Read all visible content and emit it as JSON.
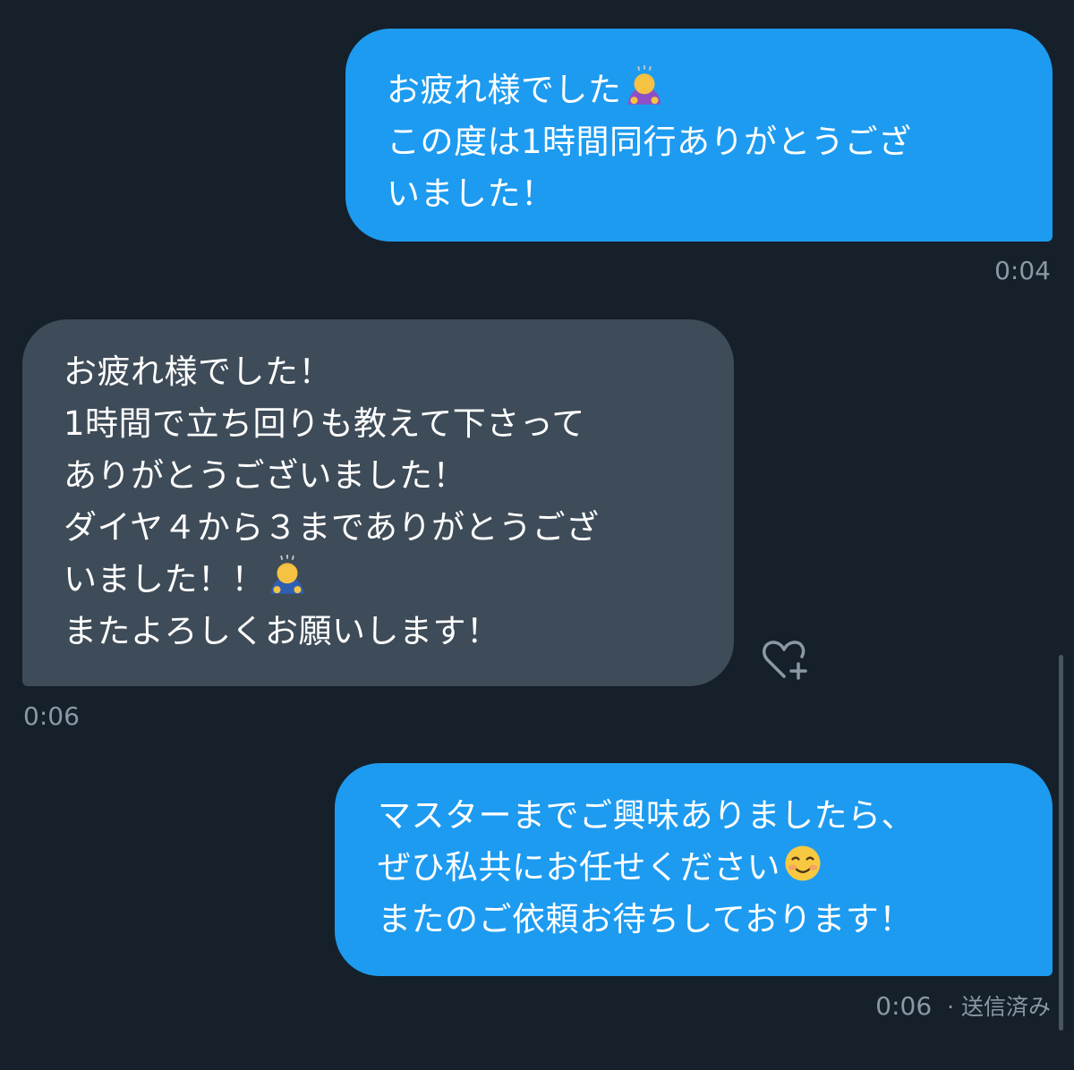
{
  "conversation": {
    "messages": [
      {
        "direction": "outgoing",
        "lines": [
          "お疲れ様でした",
          "この度は1時間同行ありがとうござ",
          "いました！"
        ],
        "emoji": "person-bowing-emoji",
        "time": "0:04"
      },
      {
        "direction": "incoming",
        "lines": [
          "お疲れ様でした！",
          "1時間で立ち回りも教えて下さって",
          "ありがとうございました！",
          "ダイヤ４から３までありがとうござ",
          "いました！！",
          "またよろしくお願いします！"
        ],
        "emoji": "person-bowing-emoji",
        "time": "0:06"
      },
      {
        "direction": "outgoing",
        "lines": [
          "マスターまでご興味ありましたら、",
          "ぜひ私共にお任せください",
          "またのご依頼お待ちしております！"
        ],
        "emoji": "smiling-face-emoji",
        "time": "0:06",
        "status": "· 送信済み"
      }
    ]
  },
  "actions": {
    "add_reaction_icon": "heart-plus-icon"
  },
  "colors": {
    "background": "#15202b",
    "outgoing_bubble": "#1d9bf0",
    "incoming_bubble": "#3e4b58",
    "timestamp": "#8b98a5",
    "text": "#ffffff"
  }
}
